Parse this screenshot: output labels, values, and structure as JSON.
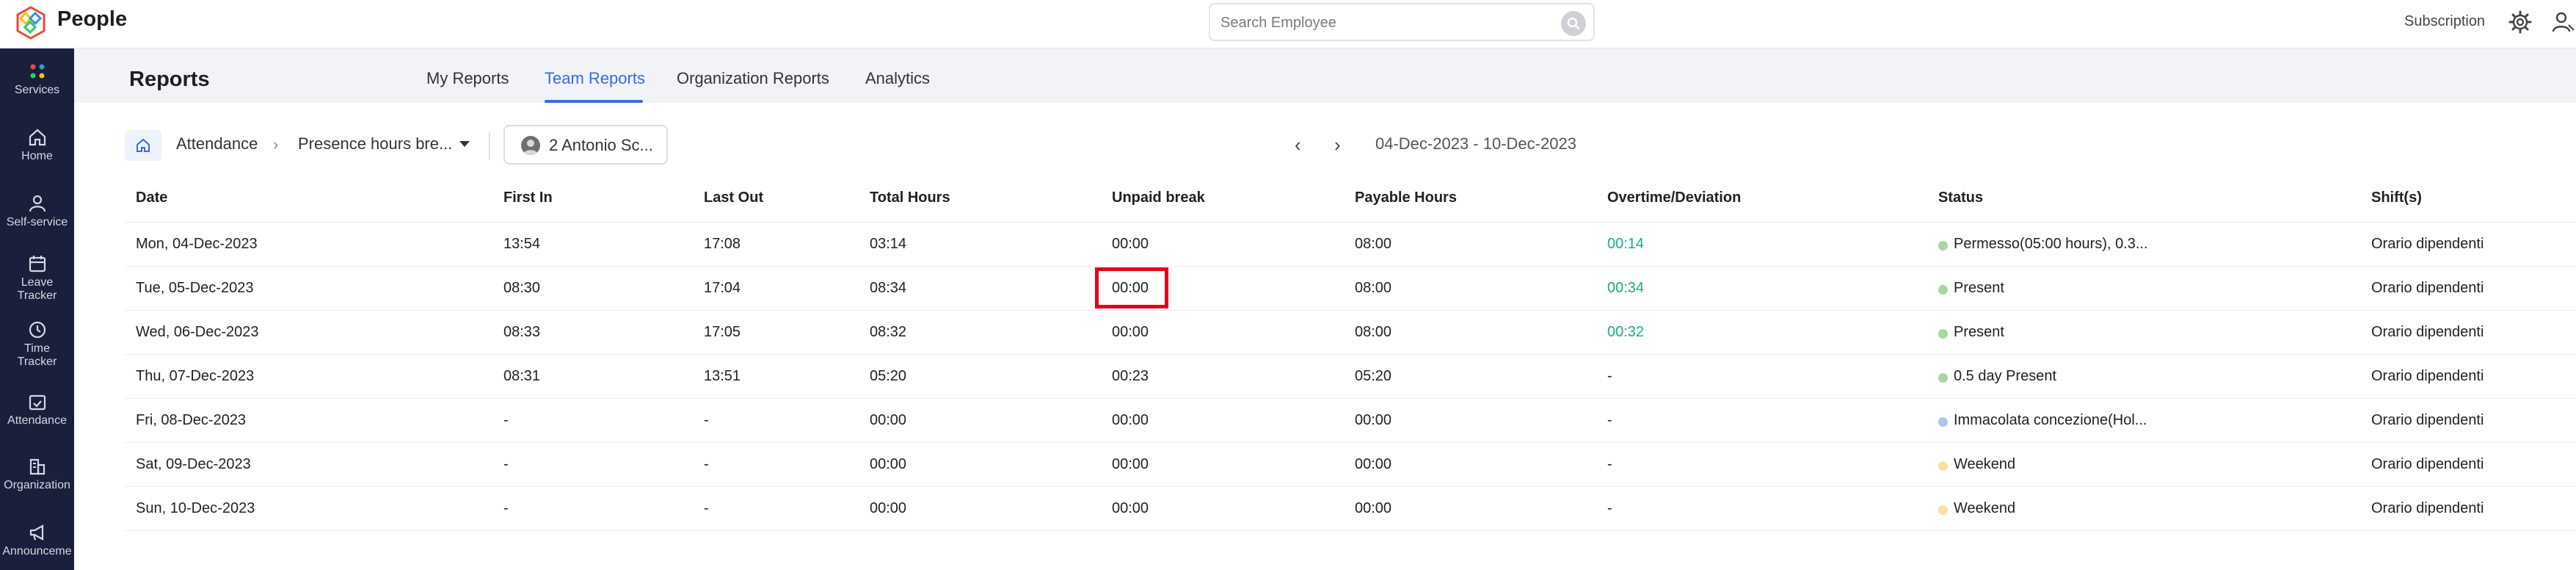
{
  "app": {
    "title": "People"
  },
  "search": {
    "placeholder": "Search Employee"
  },
  "header": {
    "subscription_label": "Subscription"
  },
  "sidebar": {
    "items": [
      {
        "label": "Services"
      },
      {
        "label": "Home"
      },
      {
        "label": "Self-service"
      },
      {
        "label": "Leave Tracker"
      },
      {
        "label": "Time Tracker"
      },
      {
        "label": "Attendance"
      },
      {
        "label": "Organization"
      },
      {
        "label": "Announceme"
      }
    ]
  },
  "page": {
    "title": "Reports"
  },
  "tabs": [
    {
      "label": "My Reports",
      "active": false
    },
    {
      "label": "Team Reports",
      "active": true
    },
    {
      "label": "Organization Reports",
      "active": false
    },
    {
      "label": "Analytics",
      "active": false
    }
  ],
  "breadcrumb": {
    "module": "Attendance",
    "report": "Presence hours bre..."
  },
  "employee_filter": {
    "label": "2 Antonio Sc..."
  },
  "date_range": "04-Dec-2023 - 10-Dec-2023",
  "table": {
    "columns": [
      "Date",
      "First In",
      "Last Out",
      "Total Hours",
      "Unpaid break",
      "Payable Hours",
      "Overtime/Deviation",
      "Status",
      "Shift(s)"
    ],
    "rows": [
      {
        "date": "Mon, 04-Dec-2023",
        "first_in": "13:54",
        "last_out": "17:08",
        "total_hours": "03:14",
        "unpaid_break": "00:00",
        "payable_hours": "08:00",
        "overtime": "00:14",
        "overtime_positive": true,
        "status": "Permesso(05:00 hours), 0.3...",
        "status_color": "#a9d6a3",
        "shift": "Orario dipendenti"
      },
      {
        "date": "Tue, 05-Dec-2023",
        "first_in": "08:30",
        "last_out": "17:04",
        "total_hours": "08:34",
        "unpaid_break": "00:00",
        "payable_hours": "08:00",
        "overtime": "00:34",
        "overtime_positive": true,
        "status": "Present",
        "status_color": "#a9d6a3",
        "shift": "Orario dipendenti"
      },
      {
        "date": "Wed, 06-Dec-2023",
        "first_in": "08:33",
        "last_out": "17:05",
        "total_hours": "08:32",
        "unpaid_break": "00:00",
        "payable_hours": "08:00",
        "overtime": "00:32",
        "overtime_positive": true,
        "status": "Present",
        "status_color": "#a9d6a3",
        "shift": "Orario dipendenti"
      },
      {
        "date": "Thu, 07-Dec-2023",
        "first_in": "08:31",
        "last_out": "13:51",
        "total_hours": "05:20",
        "unpaid_break": "00:23",
        "payable_hours": "05:20",
        "overtime": "-",
        "overtime_positive": false,
        "status": "0.5 day Present",
        "status_color": "#a9d6a3",
        "shift": "Orario dipendenti"
      },
      {
        "date": "Fri, 08-Dec-2023",
        "first_in": "-",
        "last_out": "-",
        "total_hours": "00:00",
        "unpaid_break": "00:00",
        "payable_hours": "00:00",
        "overtime": "-",
        "overtime_positive": false,
        "status": "Immacolata concezione(Hol...",
        "status_color": "#a8c8e6",
        "shift": "Orario dipendenti"
      },
      {
        "date": "Sat, 09-Dec-2023",
        "first_in": "-",
        "last_out": "-",
        "total_hours": "00:00",
        "unpaid_break": "00:00",
        "payable_hours": "00:00",
        "overtime": "-",
        "overtime_positive": false,
        "status": "Weekend",
        "status_color": "#f7e2a2",
        "shift": "Orario dipendenti"
      },
      {
        "date": "Sun, 10-Dec-2023",
        "first_in": "-",
        "last_out": "-",
        "total_hours": "00:00",
        "unpaid_break": "00:00",
        "payable_hours": "00:00",
        "overtime": "-",
        "overtime_positive": false,
        "status": "Weekend",
        "status_color": "#f7e2a2",
        "shift": "Orario dipendenti"
      }
    ]
  },
  "colors": {
    "accent": "#3b6ae0",
    "sidebar_bg": "#1a1f3b",
    "overtime_green": "#14b08a",
    "highlight": "#e3001b"
  }
}
